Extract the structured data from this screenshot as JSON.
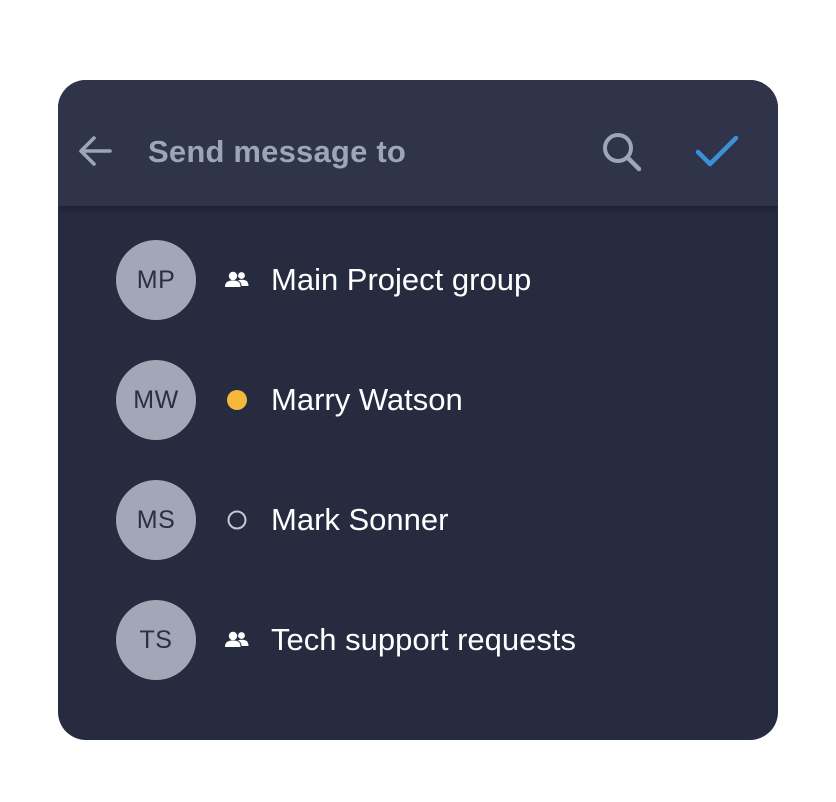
{
  "header": {
    "title": "Send message to",
    "back_icon": "arrow-left-icon",
    "search_icon": "search-icon",
    "confirm_icon": "check-icon"
  },
  "recipients": [
    {
      "initials": "MP",
      "name": "Main Project group",
      "type": "group",
      "status_icon": "group-icon"
    },
    {
      "initials": "MW",
      "name": "Marry Watson",
      "type": "user",
      "status": "away",
      "status_icon": "status-away-icon"
    },
    {
      "initials": "MS",
      "name": "Mark Sonner",
      "type": "user",
      "status": "offline",
      "status_icon": "status-offline-icon"
    },
    {
      "initials": "TS",
      "name": "Tech support requests",
      "type": "group",
      "status_icon": "group-icon"
    }
  ],
  "colors": {
    "card_bg": "#262b40",
    "header_bg": "#2f344b",
    "accent": "#3d8fd9",
    "away": "#f5b83d",
    "avatar_bg": "#a2a6b6"
  }
}
